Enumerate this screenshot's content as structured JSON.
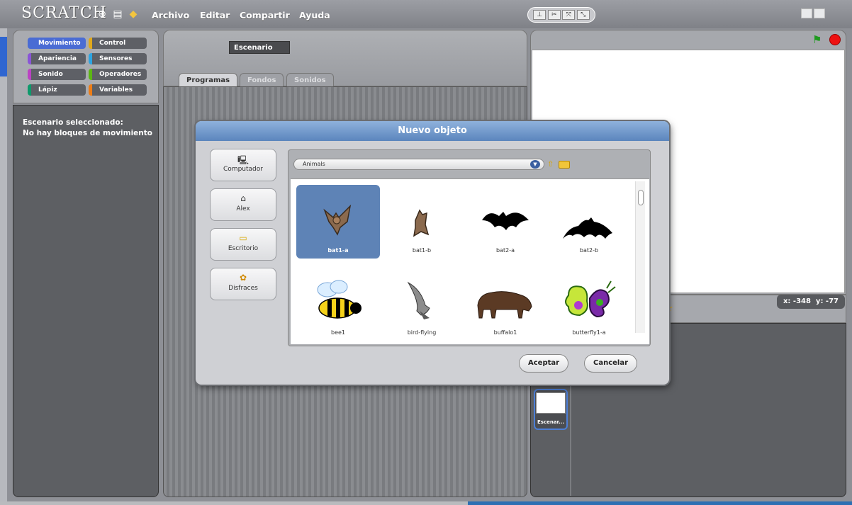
{
  "app": {
    "logo": "SCRATCH",
    "menu": [
      "Archivo",
      "Editar",
      "Compartir",
      "Ayuda"
    ]
  },
  "palette": {
    "categories": [
      {
        "label": "Movimiento",
        "color": "#4a6cd4",
        "active": true
      },
      {
        "label": "Control",
        "color": "#e1a91a",
        "active": false
      },
      {
        "label": "Apariencia",
        "color": "#8a55d7",
        "active": false
      },
      {
        "label": "Sensores",
        "color": "#2ca5e2",
        "active": false
      },
      {
        "label": "Sonido",
        "color": "#bb42c3",
        "active": false
      },
      {
        "label": "Operadores",
        "color": "#5cb712",
        "active": false
      },
      {
        "label": "Lápiz",
        "color": "#0e9a6c",
        "active": false
      },
      {
        "label": "Variables",
        "color": "#ee7d16",
        "active": false
      }
    ],
    "message_line1": "Escenario seleccionado:",
    "message_line2": "No hay bloques de movimiento"
  },
  "sprite": {
    "name": "Escenario"
  },
  "tabs": [
    "Programas",
    "Fondos",
    "Sonidos"
  ],
  "stage": {
    "mouse_x": "x: -348",
    "mouse_y": "y: -77",
    "thumb_label": "Escenar..."
  },
  "dialog": {
    "title": "Nuevo objeto",
    "locations": [
      {
        "label": "Computador",
        "icon": "computer-icon"
      },
      {
        "label": "Alex",
        "icon": "home-icon"
      },
      {
        "label": "Escritorio",
        "icon": "folder-icon"
      },
      {
        "label": "Disfraces",
        "icon": "costumes-icon"
      }
    ],
    "folder": "Animals",
    "items": [
      {
        "name": "bat1-a",
        "selected": true
      },
      {
        "name": "bat1-b",
        "selected": false
      },
      {
        "name": "bat2-a",
        "selected": false
      },
      {
        "name": "bat2-b",
        "selected": false
      },
      {
        "name": "bee1",
        "selected": false
      },
      {
        "name": "bird-flying",
        "selected": false
      },
      {
        "name": "buffalo1",
        "selected": false
      },
      {
        "name": "butterfly1-a",
        "selected": false
      }
    ],
    "ok_label": "Aceptar",
    "cancel_label": "Cancelar"
  }
}
